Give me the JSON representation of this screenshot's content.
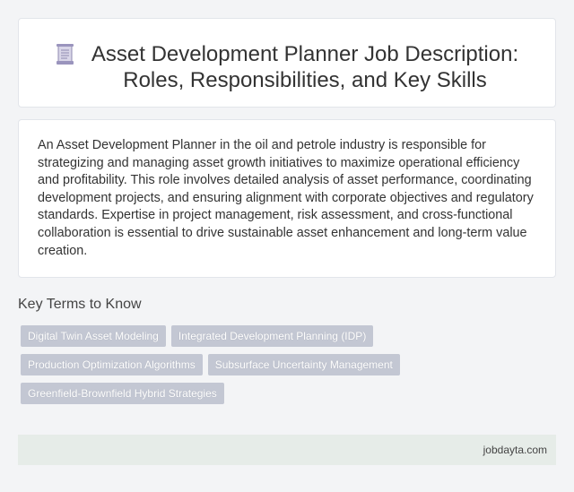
{
  "header": {
    "icon": "document-icon",
    "title_line1": "Asset Development Planner Job Description:",
    "title_line2": "Roles, Responsibilities, and Key Skills"
  },
  "description": "An Asset Development Planner in the oil and petrole industry is responsible for strategizing and managing asset growth initiatives to maximize operational efficiency and profitability. This role involves detailed analysis of asset performance, coordinating development projects, and ensuring alignment with corporate objectives and regulatory standards. Expertise in project management, risk assessment, and cross-functional collaboration is essential to drive sustainable asset enhancement and long-term value creation.",
  "key_terms": {
    "heading": "Key Terms to Know",
    "tags": [
      "Digital Twin Asset Modeling",
      "Integrated Development Planning (IDP)",
      "Production Optimization Algorithms",
      "Subsurface Uncertainty Management",
      "Greenfield-Brownfield Hybrid Strategies"
    ]
  },
  "footer": {
    "site": "jobdayta.com"
  },
  "colors": {
    "background": "#f3f4f6",
    "tag": "#c3c7d3",
    "footer": "#e6ece8"
  }
}
